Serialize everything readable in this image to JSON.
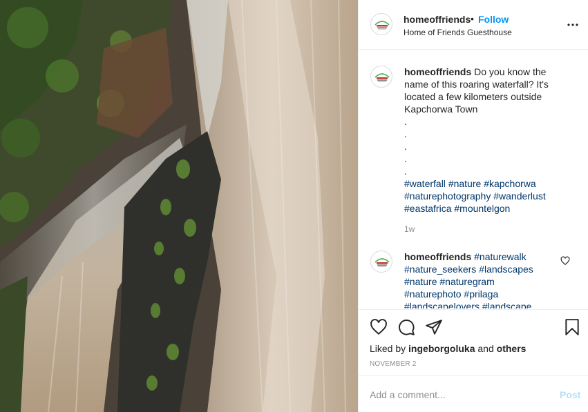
{
  "post": {
    "photo_icon": "waterfall-photo",
    "header": {
      "username": "homeoffriends",
      "separator": "•",
      "follow_label": "Follow",
      "location": "Home of Friends Guesthouse",
      "more_icon": "more-options-icon"
    },
    "caption": {
      "username": "homeoffriends",
      "text": "Do you know the name of this roaring waterfall? It's located a few kilometers outside Kapchorwa Town",
      "dots": [
        ".",
        ".",
        ".",
        ".",
        "."
      ],
      "hashtags": [
        "#waterfall",
        "#nature",
        "#kapchorwa",
        "#naturephotography",
        "#wanderlust",
        "#eastafrica",
        "#mountelgon"
      ],
      "time": "1w"
    },
    "comment": {
      "username": "homeoffriends",
      "hashtags": [
        "#naturewalk",
        "#nature_seekers",
        "#landscapes",
        "#nature",
        "#naturegram",
        "#naturephoto",
        "#prilaga",
        "#landscapelovers",
        "#landscape"
      ]
    },
    "actions": {
      "icons": [
        "heart-icon",
        "comment-icon",
        "share-icon",
        "bookmark-icon"
      ],
      "liked_by_prefix": "Liked by",
      "liked_by_user": "ingeborgoluka",
      "liked_by_and": "and",
      "liked_by_others": "others",
      "date": "NOVEMBER 2"
    },
    "add_comment": {
      "placeholder": "Add a comment...",
      "post_label": "Post"
    },
    "colors": {
      "accent": "#0095f6",
      "hashtag": "#00376b",
      "muted": "#8e8e8e",
      "post_disabled": "#b2dffc"
    }
  }
}
